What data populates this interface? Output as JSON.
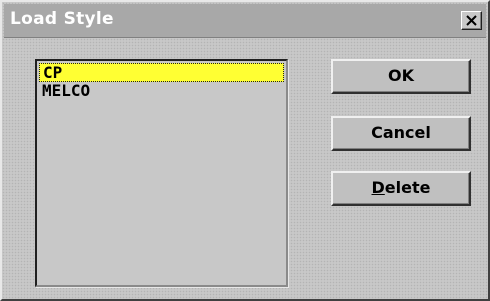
{
  "window": {
    "title": "Load Style",
    "close_icon": "close-icon"
  },
  "style_list": {
    "items": [
      {
        "label": "CP",
        "selected": true
      },
      {
        "label": "MELCO",
        "selected": false
      }
    ],
    "selection_color": "#ffff33"
  },
  "buttons": {
    "ok_label": "OK",
    "cancel_label": "Cancel",
    "delete_accel": "D",
    "delete_rest": "elete"
  }
}
